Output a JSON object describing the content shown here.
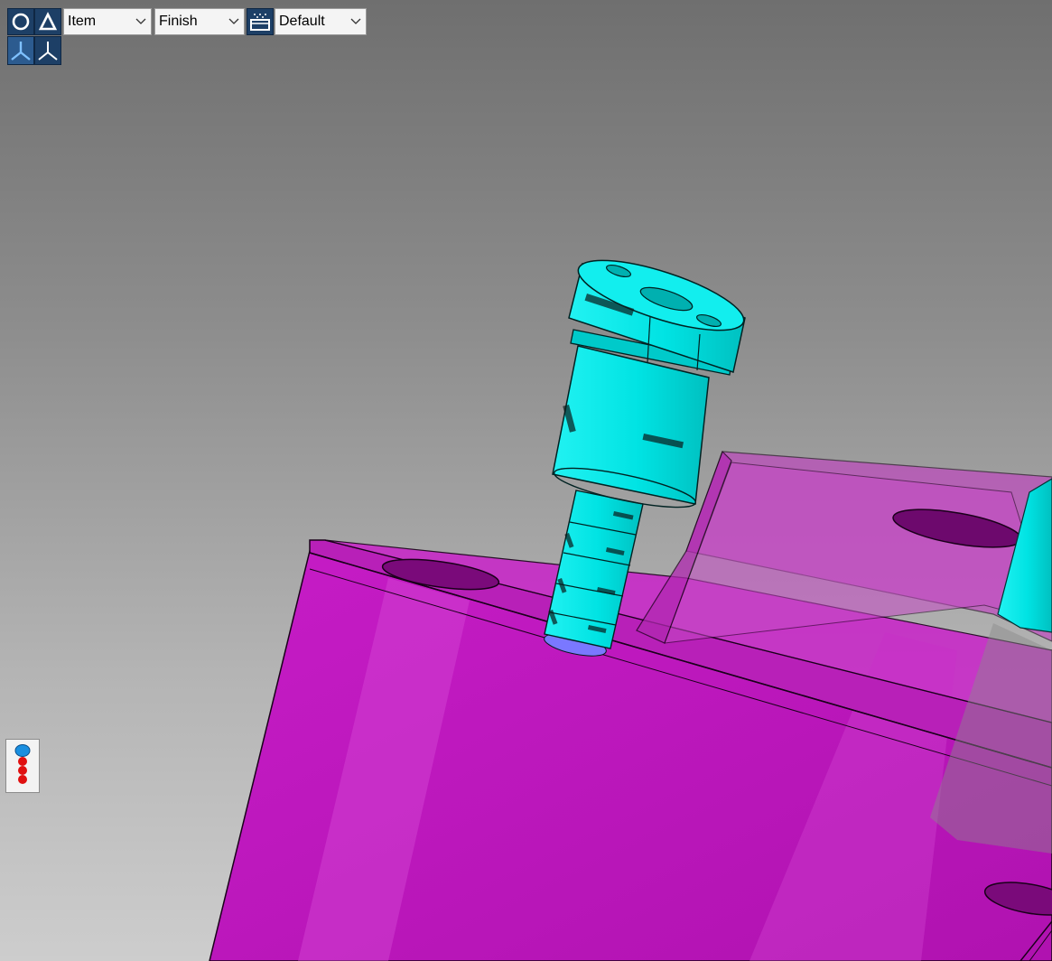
{
  "toolbar": {
    "item_dropdown": {
      "value": "Item",
      "icon": "chevron-down-icon"
    },
    "finish_dropdown": {
      "value": "Finish",
      "icon": "chevron-down-icon"
    },
    "default_dropdown": {
      "value": "Default",
      "icon": "chevron-down-icon"
    },
    "icons": [
      "display-mode-icon",
      "shading-mode-icon",
      "view-options-icon",
      "axis-view-icon",
      "axis-toggle-icon"
    ],
    "icon_bg_color": "#1d3f66"
  },
  "scene": {
    "part_color": "#cc22cc",
    "tool_color": "#00e5e5",
    "background_top": "#6f6f6f",
    "background_bottom": "#cdcdcd"
  },
  "side_widget": {
    "icon": "layer-stack-icon",
    "top_dot_color": "#1a8fe0",
    "dot_color": "#e01010"
  }
}
